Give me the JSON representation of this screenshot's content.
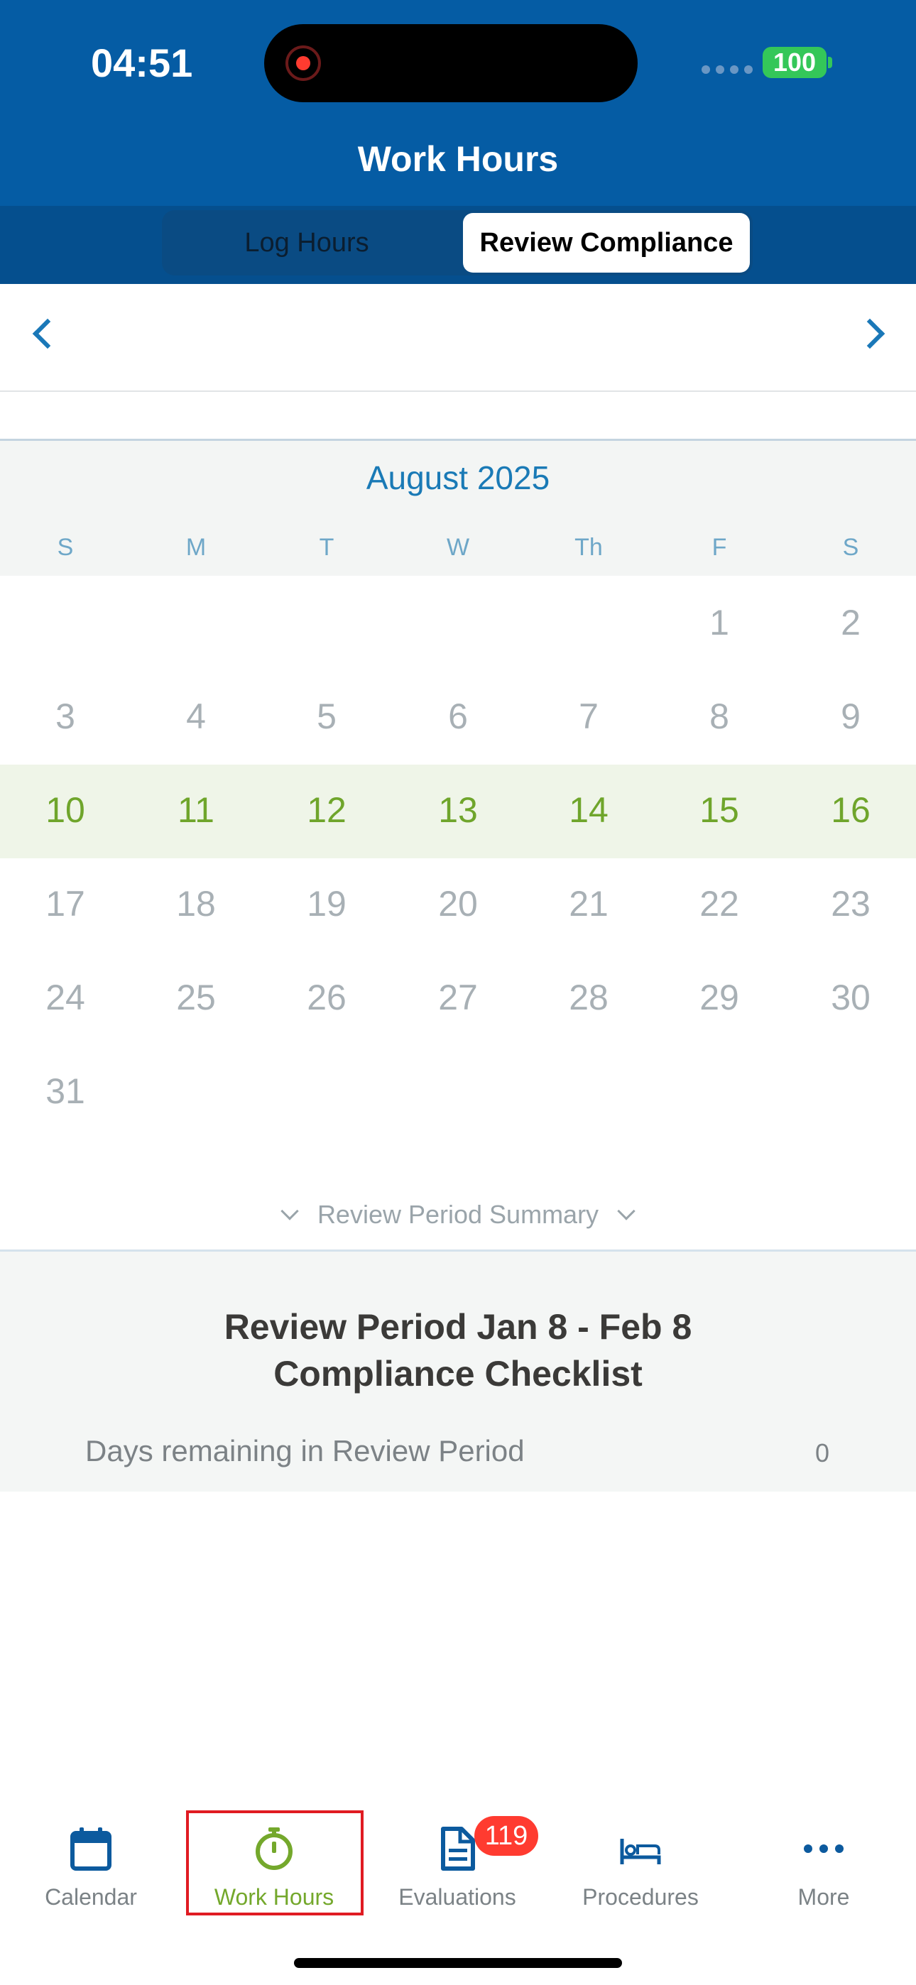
{
  "status": {
    "time": "04:51",
    "battery": "100"
  },
  "header": {
    "title": "Work Hours"
  },
  "segments": {
    "log_hours": "Log Hours",
    "review_compliance": "Review Compliance",
    "selected": "Review Compliance"
  },
  "calendar": {
    "month": "August 2025",
    "weekdays": [
      "S",
      "M",
      "T",
      "W",
      "Th",
      "F",
      "S"
    ],
    "weeks": [
      [
        "",
        "",
        "",
        "",
        "",
        "1",
        "2"
      ],
      [
        "3",
        "4",
        "5",
        "6",
        "7",
        "8",
        "9"
      ],
      [
        "10",
        "11",
        "12",
        "13",
        "14",
        "15",
        "16"
      ],
      [
        "17",
        "18",
        "19",
        "20",
        "21",
        "22",
        "23"
      ],
      [
        "24",
        "25",
        "26",
        "27",
        "28",
        "29",
        "30"
      ],
      [
        "31",
        "",
        "",
        "",
        "",
        "",
        ""
      ]
    ],
    "highlighted_week_index": 2,
    "highlight_color": "#6fa52b"
  },
  "summary": {
    "toggle_label": "Review Period Summary",
    "title_line1": "Review Period Jan 8 - Feb 8",
    "title_line2": "Compliance Checklist",
    "days_remaining_label": "Days remaining in Review Period",
    "days_remaining_value": "0"
  },
  "tabbar": {
    "items": [
      {
        "label": "Calendar",
        "icon": "calendar-icon"
      },
      {
        "label": "Work Hours",
        "icon": "stopwatch-icon"
      },
      {
        "label": "Evaluations",
        "icon": "document-icon",
        "badge": "119"
      },
      {
        "label": "Procedures",
        "icon": "bed-icon"
      },
      {
        "label": "More",
        "icon": "more-icon"
      }
    ],
    "active": "Work Hours"
  },
  "colors": {
    "header": "#055ca4",
    "accent": "#1a7ab6",
    "active_tab": "#74a82c",
    "badge": "#ff3b30"
  }
}
